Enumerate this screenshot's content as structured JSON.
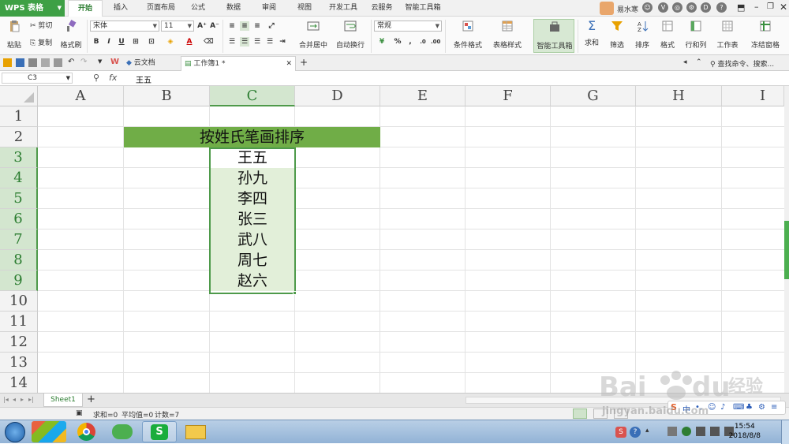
{
  "app": {
    "logo": "WPS 表格",
    "menu_tabs": [
      "开始",
      "插入",
      "页面布局",
      "公式",
      "数据",
      "审阅",
      "视图",
      "开发工具",
      "云服务",
      "智能工具箱"
    ],
    "active_tab": "开始",
    "user_name": "易水寒"
  },
  "ribbon": {
    "paste": "粘贴",
    "cut": "剪切",
    "copy": "复制",
    "format_painter": "格式刷",
    "font_name": "宋体",
    "font_size": "11",
    "bold": "B",
    "italic": "I",
    "underline": "U",
    "merge_center": "合并居中",
    "wrap_text": "自动换行",
    "number_format": "常规",
    "conditional_format": "条件格式",
    "table_style": "表格样式",
    "smart_toolbox": "智能工具箱",
    "sum": "求和",
    "filter": "筛选",
    "sort": "排序",
    "format": "格式",
    "row_col": "行和列",
    "worksheet": "工作表",
    "freeze": "冻结窗格"
  },
  "docbar": {
    "cloud_docs": "云文档",
    "workbook_tab": "工作簿1 *",
    "search_placeholder": "查找命令、搜索..."
  },
  "formula_bar": {
    "cell_ref": "C3",
    "fx": "fx",
    "value": "王五"
  },
  "grid": {
    "columns": [
      "A",
      "B",
      "C",
      "D",
      "E",
      "F",
      "G",
      "H",
      "I"
    ],
    "rows": [
      "1",
      "2",
      "3",
      "4",
      "5",
      "6",
      "7",
      "8",
      "9",
      "10",
      "11",
      "12",
      "13",
      "14"
    ],
    "header_text": "按姓氏笔画排序",
    "names": [
      "王五",
      "孙九",
      "李四",
      "张三",
      "武八",
      "周七",
      "赵六"
    ]
  },
  "sheet_tabs": {
    "sheet1": "Sheet1",
    "add": "+"
  },
  "status": {
    "sum": "求和=0",
    "average": "平均值=0",
    "count": "计数=7"
  },
  "taskbar": {
    "time": "15:54",
    "date": "2018/8/8"
  },
  "watermark": {
    "text": "jingyan.baidu.com",
    "brand": "Baidu 经验"
  },
  "colors": {
    "accent_green": "#3ea045",
    "header_fill": "#70ad47",
    "selection_fill": "#e2efd9",
    "selection_border": "#4e9a4a"
  }
}
